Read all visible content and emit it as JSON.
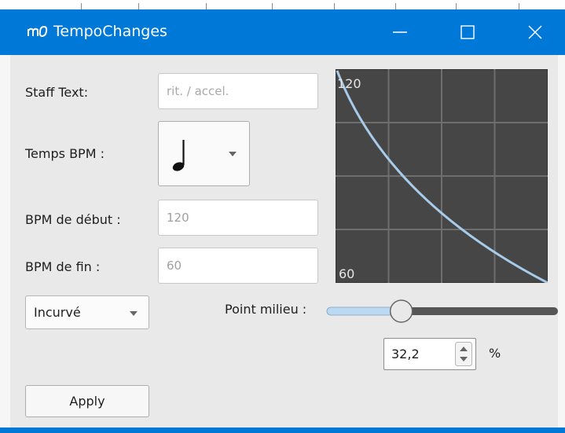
{
  "window": {
    "title": "TempoChanges",
    "accent_color": "#0078d7"
  },
  "form": {
    "staff_text_label": "Staff Text:",
    "staff_text_placeholder": "rit. / accel.",
    "beat_label": "Temps BPM :",
    "beat_note_icon": "quarter-note-icon",
    "start_bpm_label": "BPM de début :",
    "start_bpm_value": "120",
    "end_bpm_label": "BPM de fin :",
    "end_bpm_value": "60",
    "curve_type": "Incurvé",
    "midpoint_label": "Point milieu :",
    "midpoint_value": "32,2",
    "midpoint_unit": "%",
    "midpoint_fraction": 0.322,
    "apply_label": "Apply"
  },
  "graph": {
    "top_label": "120",
    "bottom_label": "60",
    "background_color": "#464646",
    "grid_color": "#6e6e6e",
    "curve_color": "#a8cbea",
    "grid_columns": 4,
    "grid_rows": 4
  }
}
